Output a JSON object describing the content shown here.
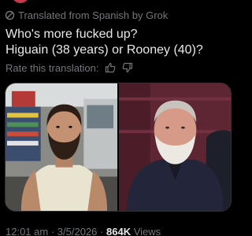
{
  "translation": {
    "label": "Translated from Spanish by Grok"
  },
  "post": {
    "line1": "Who's more fucked up?",
    "line2": "Higuain (38 years) or Rooney (40)?"
  },
  "rate": {
    "label": "Rate this translation:"
  },
  "media": {
    "photos": [
      {
        "alt": "bearded man in white tank top"
      },
      {
        "alt": "white-bearded man in dark jacket"
      }
    ]
  },
  "meta": {
    "time": "12:01 am",
    "separator": "·",
    "date": "3/5/2026",
    "views_count": "864K",
    "views_label": "Views"
  },
  "colors": {
    "background": "#000000",
    "text_primary": "#e7e9ea",
    "text_secondary": "#71767b"
  }
}
